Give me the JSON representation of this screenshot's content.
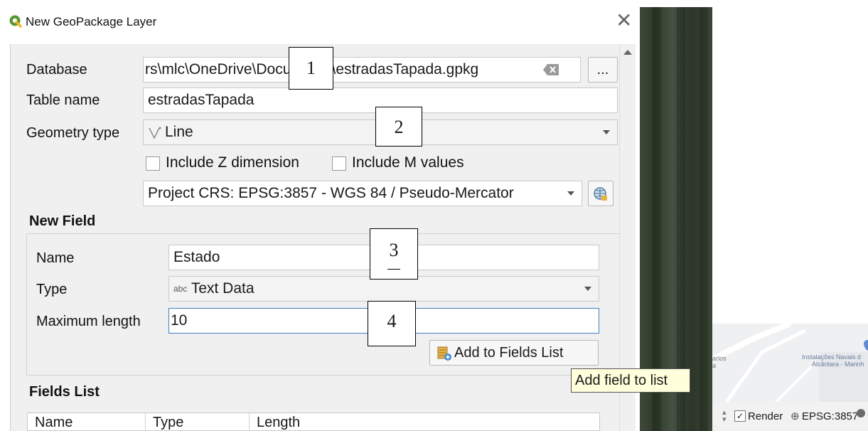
{
  "dialog": {
    "title": "New GeoPackage Layer",
    "database_label": "Database",
    "database_value": "rs\\mlc\\OneDrive\\Documents\\estradasTapada.gpkg",
    "browse_label": "...",
    "table_name_label": "Table name",
    "table_name_value": "estradasTapada",
    "geometry_type_label": "Geometry type",
    "geometry_type_value": "Line",
    "include_z_label": "Include Z dimension",
    "include_m_label": "Include M values",
    "crs_value": "Project CRS: EPSG:3857 - WGS 84 / Pseudo-Mercator"
  },
  "new_field": {
    "heading": "New Field",
    "name_label": "Name",
    "name_value": "Estado",
    "type_label": "Type",
    "type_badge": "abc",
    "type_value": "Text Data",
    "max_length_label": "Maximum length",
    "max_length_value": "10",
    "add_button_label": "Add to Fields List"
  },
  "fields_list": {
    "heading": "Fields List",
    "columns": [
      "Name",
      "Type",
      "Length"
    ]
  },
  "tooltip": "Add field to list",
  "callouts": [
    "1",
    "2",
    "3",
    "4"
  ],
  "mini_map": {
    "label_left_1": "arlos",
    "label_left_2": "a",
    "label_right_1": "Instalações Navais d",
    "label_right_2": "Alcântara - Marinh"
  },
  "statusbar": {
    "render_label": "Render",
    "crs_label": "EPSG:3857"
  },
  "colors": {
    "qgis_green": "#589632",
    "tooltip_bg": "#ffffdc",
    "focus_blue": "#3b82c4"
  }
}
